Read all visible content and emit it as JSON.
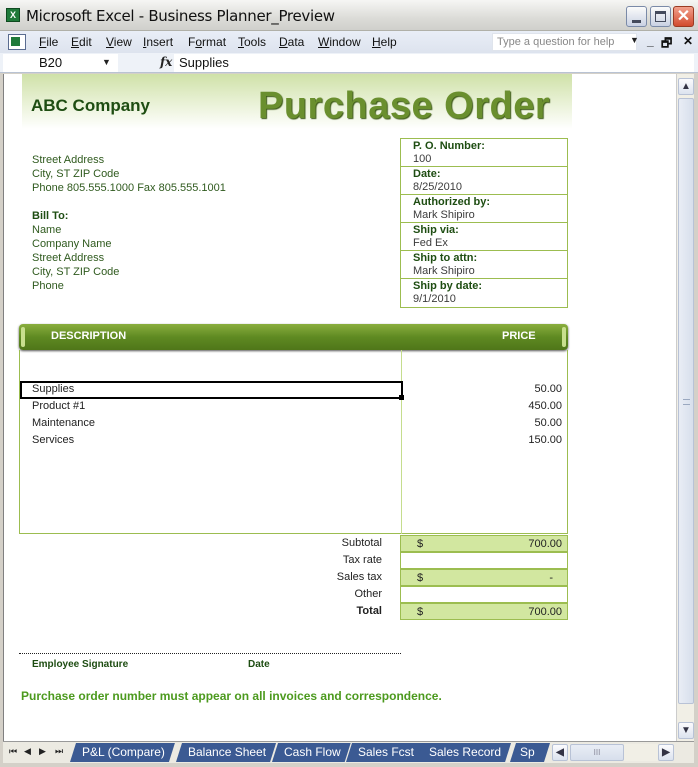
{
  "window": {
    "title": "Microsoft Excel - Business Planner_Preview",
    "app_icon": "excel-icon",
    "controls": {
      "minimize": "minimize-icon",
      "maximize": "maximize-icon",
      "close_glyph": "✕"
    }
  },
  "menubar": {
    "items": [
      {
        "mnemonic": "F",
        "rest": "ile"
      },
      {
        "mnemonic": "E",
        "rest": "dit"
      },
      {
        "mnemonic": "V",
        "rest": "iew"
      },
      {
        "mnemonic": "I",
        "rest": "nsert"
      },
      {
        "pre": "F",
        "mnemonic": "o",
        "rest": "rmat"
      },
      {
        "mnemonic": "T",
        "rest": "ools"
      },
      {
        "mnemonic": "D",
        "rest": "ata"
      },
      {
        "mnemonic": "W",
        "rest": "indow"
      },
      {
        "mnemonic": "H",
        "rest": "elp"
      }
    ],
    "help_placeholder": "Type a question for help",
    "mdi_min": "_",
    "mdi_restore": "🗗",
    "mdi_close": "✕"
  },
  "formula_bar": {
    "cell_ref": "B20",
    "fx_label": "fx",
    "value": "Supplies"
  },
  "document": {
    "company": "ABC Company",
    "title": "Purchase Order",
    "address": [
      "Street Address",
      "City, ST  ZIP Code",
      "Phone 805.555.1000   Fax 805.555.1001"
    ],
    "bill_to_label": "Bill To:",
    "bill_to": [
      "Name",
      "Company Name",
      "Street Address",
      "City, ST  ZIP Code",
      "Phone"
    ],
    "info": [
      {
        "label": "P. O. Number:",
        "value": "100"
      },
      {
        "label": "Date:",
        "value": "8/25/2010"
      },
      {
        "label": "Authorized by:",
        "value": "Mark Shipiro"
      },
      {
        "label": "Ship via:",
        "value": "Fed Ex"
      },
      {
        "label": "Ship to attn:",
        "value": "Mark Shipiro"
      },
      {
        "label": "Ship by date:",
        "value": "9/1/2010"
      }
    ],
    "table_headers": {
      "description": "DESCRIPTION",
      "price": "PRICE"
    },
    "items": [
      {
        "description": "Supplies",
        "price": "50.00"
      },
      {
        "description": "Product #1",
        "price": "450.00"
      },
      {
        "description": "Maintenance",
        "price": "50.00"
      },
      {
        "description": "Services",
        "price": "150.00"
      }
    ],
    "totals": [
      {
        "label": "Subtotal",
        "currency": "$",
        "amount": "700.00"
      },
      {
        "label": "Tax rate",
        "currency": "",
        "amount": ""
      },
      {
        "label": "Sales tax",
        "currency": "$",
        "amount": "-"
      },
      {
        "label": "Other",
        "currency": "",
        "amount": ""
      },
      {
        "label": "Total",
        "currency": "$",
        "amount": "700.00"
      }
    ],
    "signature_label": "Employee Signature",
    "date_label": "Date",
    "notice": "Purchase order number must appear on all invoices and correspondence."
  },
  "sheet_tabs": {
    "nav": [
      "⏮",
      "◀",
      "▶",
      "⏭"
    ],
    "tabs": [
      "P&L (Compare)",
      "Balance Sheet",
      "Cash Flow",
      "Sales Fcst",
      "Sales Record",
      "Sp"
    ]
  },
  "scroll": {
    "up": "▲",
    "down": "▼",
    "left": "◀",
    "right": "▶",
    "grip": "III"
  },
  "colors": {
    "accent_green": "#6a8f2e",
    "dark_green": "#1e4d12",
    "fill_green": "#d2e7a0",
    "tab_blue": "#3b5a93"
  }
}
